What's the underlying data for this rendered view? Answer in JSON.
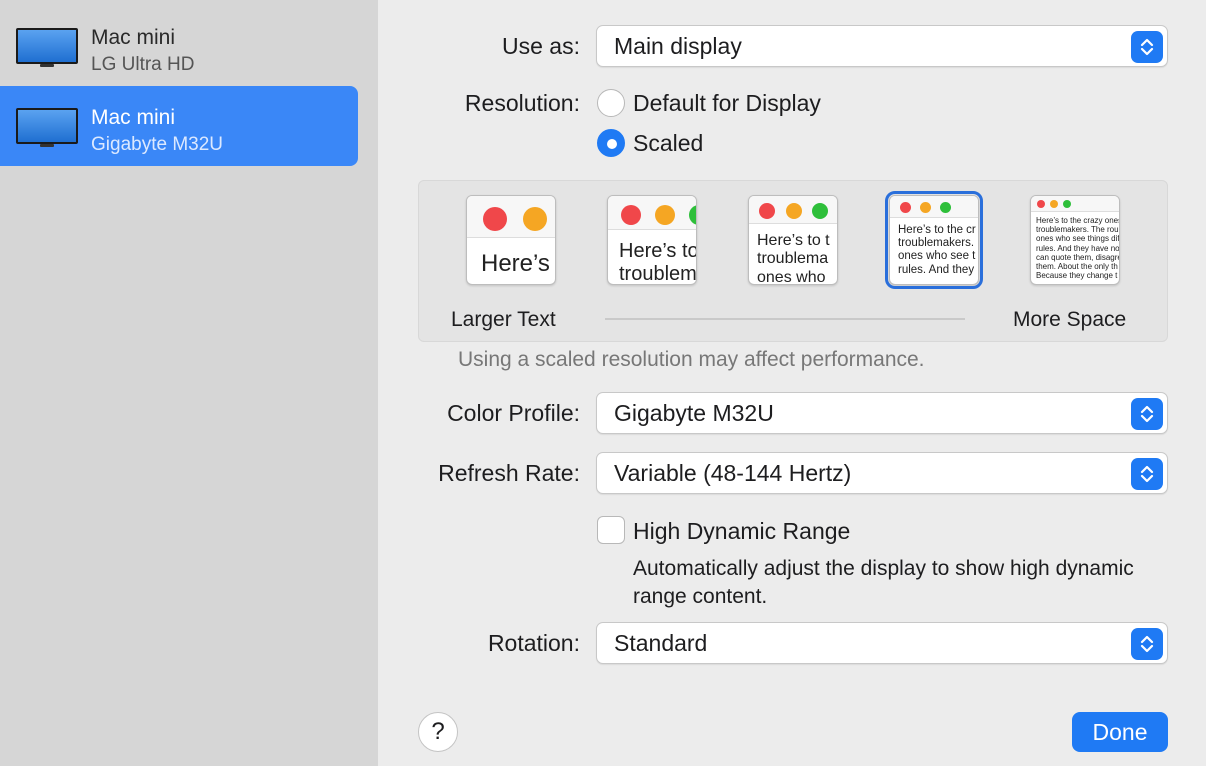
{
  "sidebar": {
    "items": [
      {
        "name": "Mac mini",
        "model": "LG Ultra HD",
        "selected": false
      },
      {
        "name": "Mac mini",
        "model": "Gigabyte M32U",
        "selected": true
      }
    ]
  },
  "settings": {
    "use_as_label": "Use as:",
    "use_as_value": "Main display",
    "resolution_label": "Resolution:",
    "resolution_options": [
      "Default for Display",
      "Scaled"
    ],
    "resolution_selected": "Scaled",
    "scale_thumbs": [
      {
        "text": "Here’s"
      },
      {
        "text": "Here’s to\ntroublem"
      },
      {
        "text": "Here’s to t\ntroublema\nones who"
      },
      {
        "text": "Here’s to the cr\ntroublemakers.\nones who see t\nrules. And they"
      },
      {
        "text": "Here’s to the crazy ones\ntroublemakers. The rou\nones who see things diff\nrules. And they have no\ncan quote them, disagre\nthem. About the only th\nBecause they change t"
      }
    ],
    "scale_selected_index": 3,
    "larger_text_label": "Larger Text",
    "more_space_label": "More Space",
    "scaled_note": "Using a scaled resolution may affect performance.",
    "color_profile_label": "Color Profile:",
    "color_profile_value": "Gigabyte M32U",
    "refresh_rate_label": "Refresh Rate:",
    "refresh_rate_value": "Variable (48-144 Hertz)",
    "hdr_label": "High Dynamic Range",
    "hdr_checked": false,
    "hdr_description": "Automatically adjust the display to show high dynamic range content.",
    "rotation_label": "Rotation:",
    "rotation_value": "Standard"
  },
  "footer": {
    "help_label": "?",
    "done_label": "Done"
  },
  "colors": {
    "accent": "#1f7af4",
    "sidebar_selected": "#3a87f7",
    "traffic_red": "#f0474a",
    "traffic_yellow": "#f5a623",
    "traffic_green": "#2ebf3a"
  }
}
